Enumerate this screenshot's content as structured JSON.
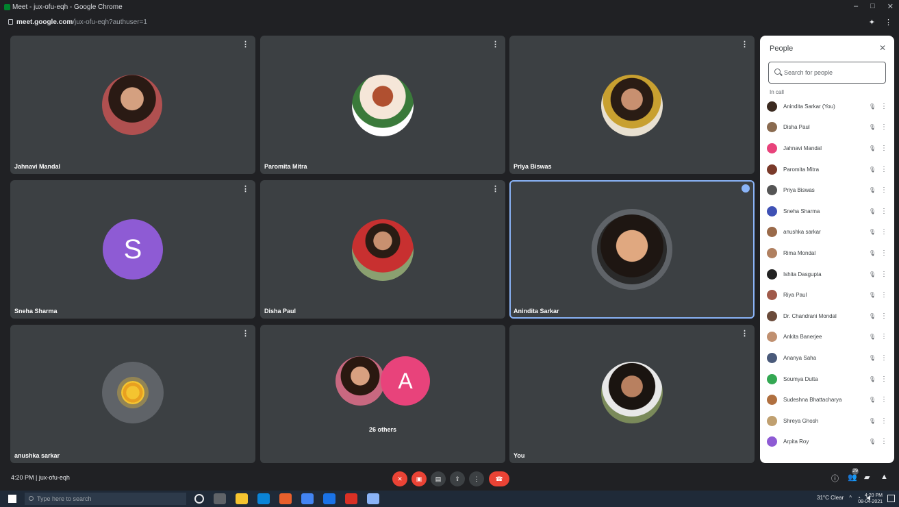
{
  "browser": {
    "title": "Meet - jux-ofu-eqh - Google Chrome",
    "url_domain": "meet.google.com",
    "url_path": "/jux-ofu-eqh?authuser=1",
    "window_buttons": [
      "–",
      "□",
      "✕"
    ]
  },
  "tiles": [
    {
      "name": "Jahnavi Mandal",
      "avatar": "photo"
    },
    {
      "name": "Paromita Mitra",
      "avatar": "cartoon"
    },
    {
      "name": "Priya Biswas",
      "avatar": "photo"
    },
    {
      "name": "Sneha Sharma",
      "avatar": "letter",
      "letter": "S",
      "color": "#8e5bd4"
    },
    {
      "name": "Disha Paul",
      "avatar": "photo"
    },
    {
      "name": "Anindita Sarkar",
      "avatar": "photo",
      "active": true
    },
    {
      "name": "anushka sarkar",
      "avatar": "sun"
    },
    {
      "name": "26 others",
      "avatar": "group",
      "letter": "A",
      "color": "#e8437b"
    },
    {
      "name": "You",
      "avatar": "photo"
    }
  ],
  "people_panel": {
    "title": "People",
    "search_placeholder": "Search for people",
    "section": "In call",
    "participants": [
      {
        "name": "Anindita Sarkar (You)",
        "color": "#3b2a20"
      },
      {
        "name": "Disha Paul",
        "color": "#8a6b50"
      },
      {
        "name": "Jahnavi Mandal",
        "color": "#e8437b"
      },
      {
        "name": "Paromita Mitra",
        "color": "#7a3a2a"
      },
      {
        "name": "Priya Biswas",
        "color": "#555555"
      },
      {
        "name": "Sneha Sharma",
        "color": "#3f51b5"
      },
      {
        "name": "anushka sarkar",
        "color": "#9a6a4a"
      },
      {
        "name": "Rima Mondal",
        "color": "#b08060"
      },
      {
        "name": "Ishita Dasgupta",
        "color": "#222222"
      },
      {
        "name": "Riya Paul",
        "color": "#a05a4a"
      },
      {
        "name": "Dr. Chandrani Mondal",
        "color": "#6a4a3a"
      },
      {
        "name": "Ankita Banerjee",
        "color": "#c09070"
      },
      {
        "name": "Ananya Saha",
        "color": "#4a5a7a"
      },
      {
        "name": "Soumya Dutta",
        "color": "#34a853"
      },
      {
        "name": "Sudeshna Bhattacharya",
        "color": "#b07040"
      },
      {
        "name": "Shreya Ghosh",
        "color": "#c0a070"
      },
      {
        "name": "Arpita Roy",
        "color": "#8e5bd4"
      }
    ]
  },
  "controls": {
    "time": "4:20 PM",
    "meeting_code": "jux-ofu-eqh",
    "people_count": "29"
  },
  "taskbar": {
    "search_placeholder": "Type here to search",
    "weather": "31°C Clear",
    "time": "4:20 PM",
    "date": "08-04-2021"
  }
}
